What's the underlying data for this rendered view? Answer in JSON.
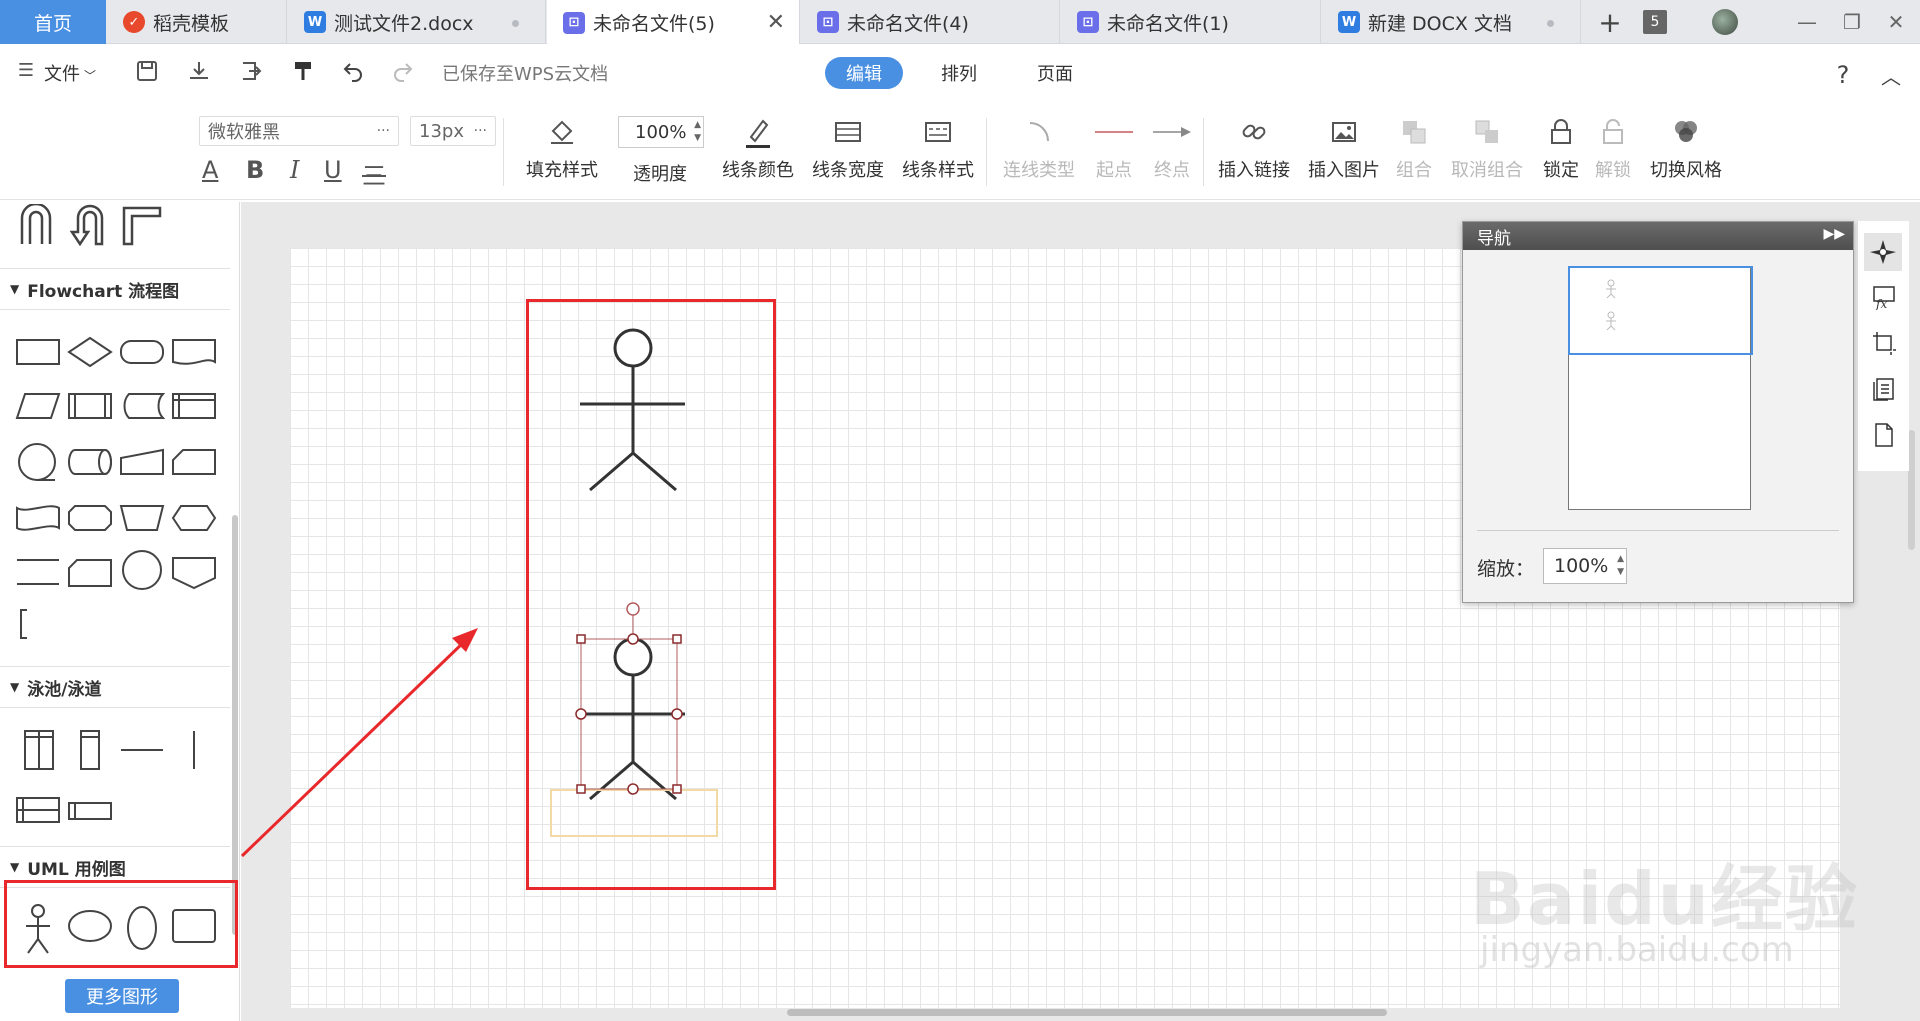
{
  "tabs": {
    "home": "首页",
    "template": "稻壳模板",
    "doc1": "测试文件2.docx",
    "active": "未命名文件(5)",
    "doc4": "未命名文件(4)",
    "doc1b": "未命名文件(1)",
    "newdocx": "新建 DOCX 文档",
    "count": "5"
  },
  "menu": {
    "file": "文件",
    "saved_status": "已保存至WPS云文档",
    "modes": [
      "编辑",
      "排列",
      "页面"
    ],
    "active_mode": "编辑"
  },
  "toolbar": {
    "font_name": "微软雅黑",
    "font_size": "13px",
    "fill_style": "填充样式",
    "opacity_label": "透明度",
    "opacity_value": "100%",
    "line_color": "线条颜色",
    "line_width": "线条宽度",
    "line_style": "线条样式",
    "connector_type": "连线类型",
    "start_point": "起点",
    "end_point": "终点",
    "insert_link": "插入链接",
    "insert_image": "插入图片",
    "group": "组合",
    "ungroup": "取消组合",
    "lock": "锁定",
    "unlock": "解锁",
    "switch_style": "切换风格"
  },
  "left_panel": {
    "flowchart_title": "Flowchart 流程图",
    "swimlane_title": "泳池/泳道",
    "uml_title": "UML 用例图",
    "more_shapes": "更多图形"
  },
  "navigator": {
    "title": "导航",
    "zoom_label": "缩放：",
    "zoom_value": "100%"
  },
  "watermark": {
    "brand": "Baidu经验",
    "url": "jingyan.baidu.com"
  },
  "colors": {
    "accent": "#4a90e2",
    "annotation_red": "#e8282b",
    "selection_handle": "#8b2a2a",
    "label_box": "#f3d9a3"
  }
}
